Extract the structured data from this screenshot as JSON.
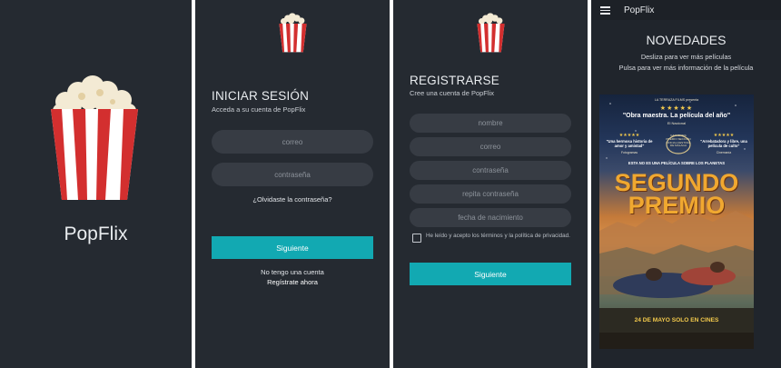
{
  "splash": {
    "app_name": "PopFlix"
  },
  "login": {
    "title": "INICIAR SESIÓN",
    "subtitle": "Acceda a su cuenta de PopFlix",
    "email_placeholder": "correo",
    "password_placeholder": "contraseña",
    "forgot_link": "¿Olvidaste la contraseña?",
    "next_button": "Siguiente",
    "no_account": "No tengo una cuenta",
    "register_now": "Regístrate ahora"
  },
  "register": {
    "title": "REGISTRARSE",
    "subtitle": "Cree una cuenta de PopFlix",
    "fields": [
      "nombre",
      "correo",
      "contraseña",
      "repita contraseña",
      "fecha de nacimiento"
    ],
    "terms_label": "He leído y acepto los términos y la política de privacidad.",
    "terms_checked": false,
    "next_button": "Siguiente"
  },
  "news": {
    "app_title": "PopFlix",
    "heading": "NOVEDADES",
    "hint_swipe": "Desliza para ver más películas",
    "hint_tap": "Pulsa para ver más información de la película",
    "poster": {
      "presenter": "LA TERRAZA FILMS presenta",
      "quote_main": "\"Obra maestra. La película del año\"",
      "quote_main_source": "El Nacional",
      "quote_left": "\"Una hermosa historia de amor y amistad\"",
      "quote_left_source": "Fotogramas",
      "festival": "GANADORA PREMIO SECCIÓN OFICIAL FESTIVAL DE MÁLAGA",
      "quote_right": "\"Arrebatadora y libre, una película de culto\"",
      "quote_right_source": "Cinemanía",
      "tagline": "ESTA NO ES UNA PELÍCULA SOBRE LOS PLANETAS",
      "title_line1": "SEGUNDO",
      "title_line2": "PREMIO",
      "release": "24 DE MAYO SOLO EN CINES"
    }
  },
  "colors": {
    "background": "#252a31",
    "field": "#373c44",
    "accent": "#12a9b2",
    "popcorn_red": "#d32f2f"
  }
}
